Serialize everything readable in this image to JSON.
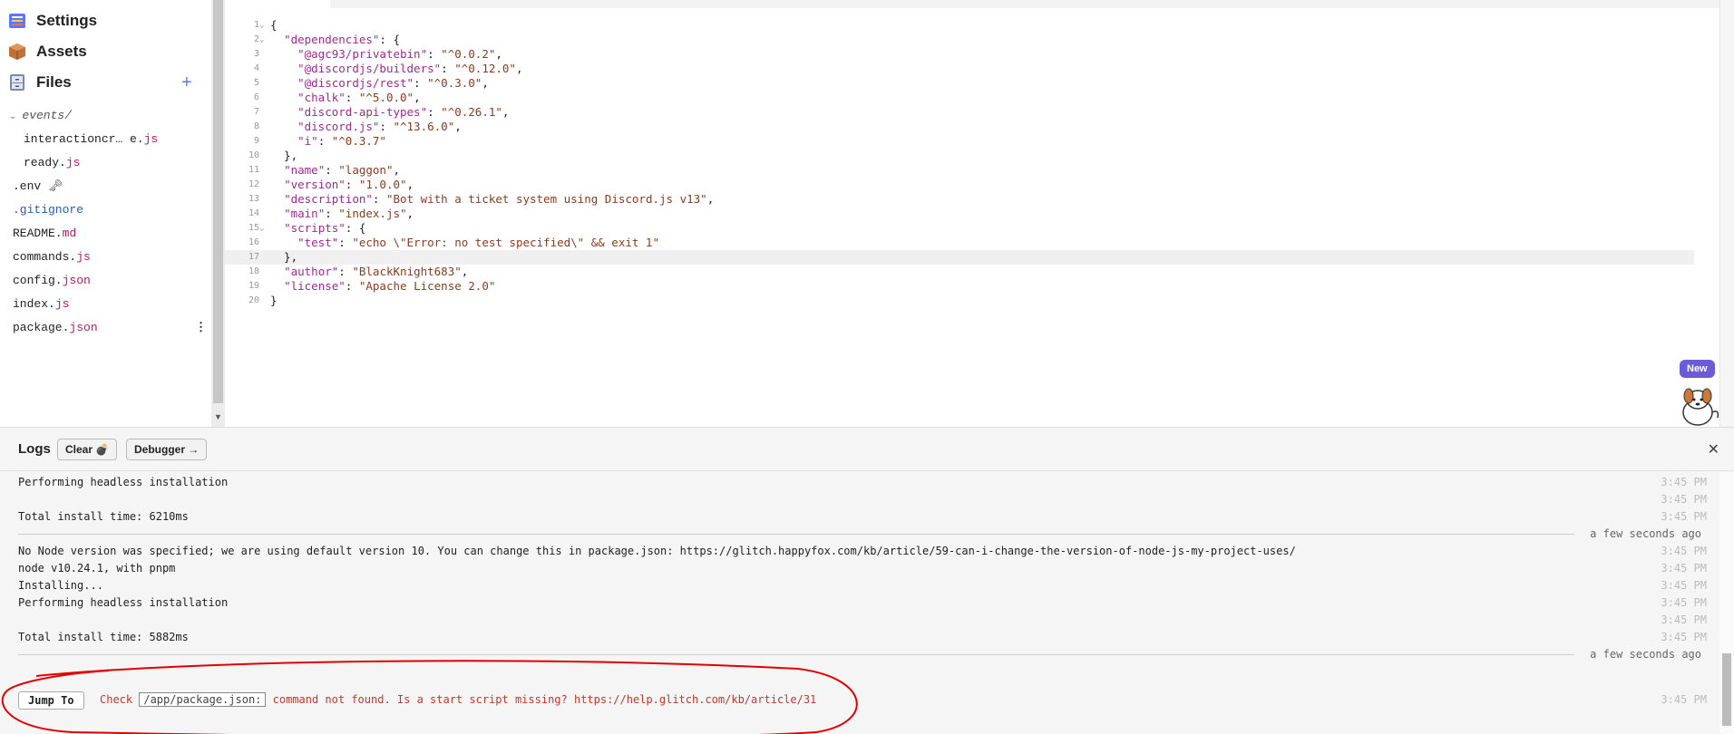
{
  "sidebar": {
    "settings": "Settings",
    "assets": "Assets",
    "files": "Files",
    "add_symbol": "+",
    "folder": "events/",
    "files_list": [
      {
        "name": "interactioncr… e.",
        "ext": "js",
        "indent": true
      },
      {
        "name": "ready.",
        "ext": "js",
        "indent": true
      },
      {
        "name": ".env ",
        "ext": "🗝",
        "indent": false
      },
      {
        "name": ".gitignore",
        "ext": "",
        "indent": false
      },
      {
        "name": "README.",
        "ext": "md",
        "indent": false
      },
      {
        "name": "commands.",
        "ext": "js",
        "indent": false
      },
      {
        "name": "config.",
        "ext": "json",
        "indent": false
      },
      {
        "name": "index.",
        "ext": "js",
        "indent": false
      },
      {
        "name": "package.",
        "ext": "json",
        "indent": false
      }
    ],
    "kebab": "⋮"
  },
  "editor": {
    "active_line": 17,
    "lines": [
      "{",
      "  \"dependencies\": {",
      "    \"@agc93/privatebin\": \"^0.0.2\",",
      "    \"@discordjs/builders\": \"^0.12.0\",",
      "    \"@discordjs/rest\": \"^0.3.0\",",
      "    \"chalk\": \"^5.0.0\",",
      "    \"discord-api-types\": \"^0.26.1\",",
      "    \"discord.js\": \"^13.6.0\",",
      "    \"i\": \"^0.3.7\"",
      "  },",
      "  \"name\": \"laggon\",",
      "  \"version\": \"1.0.0\",",
      "  \"description\": \"Bot with a ticket system using Discord.js v13\",",
      "  \"main\": \"index.js\",",
      "  \"scripts\": {",
      "    \"test\": \"echo \\\"Error: no test specified\\\" && exit 1\"",
      "  },",
      "  \"author\": \"BlackKnight683\",",
      "  \"license\": \"Apache License 2.0\"",
      "}"
    ],
    "fold_lines": [
      1,
      2,
      15
    ]
  },
  "badge": {
    "label": "New"
  },
  "logs": {
    "title": "Logs",
    "clear_label": "Clear 💣",
    "debugger_label": "Debugger →",
    "close": "✕",
    "rows": [
      {
        "type": "msg",
        "text": "Performing headless installation",
        "time": "3:45 PM"
      },
      {
        "type": "msg",
        "text": "",
        "time": "3:45 PM"
      },
      {
        "type": "msg",
        "text": "Total install time: 6210ms",
        "time": "3:45 PM"
      },
      {
        "type": "sep",
        "text": "a few seconds ago"
      },
      {
        "type": "msg",
        "text": "No Node version was specified; we are using default version 10. You can change this in package.json: https://glitch.happyfox.com/kb/article/59-can-i-change-the-version-of-node-js-my-project-uses/",
        "time": "3:45 PM"
      },
      {
        "type": "msg",
        "text": "node v10.24.1, with pnpm",
        "time": "3:45 PM"
      },
      {
        "type": "msg",
        "text": "Installing...",
        "time": "3:45 PM"
      },
      {
        "type": "msg",
        "text": "Performing headless installation",
        "time": "3:45 PM"
      },
      {
        "type": "msg",
        "text": "",
        "time": "3:45 PM"
      },
      {
        "type": "msg",
        "text": "Total install time: 5882ms",
        "time": "3:45 PM"
      },
      {
        "type": "sep",
        "text": "a few seconds ago"
      }
    ],
    "error": {
      "jump_label": "Jump To",
      "prefix": "Check ",
      "path": "/app/package.json:",
      "suffix": " command not found. Is a start script missing? https://help.glitch.com/kb/article/31",
      "time": "3:45 PM"
    }
  },
  "colors": {
    "accent": "#5a78ff",
    "badge": "#6b5bd6",
    "error": "#c0392b",
    "annotation": "#e00000"
  }
}
